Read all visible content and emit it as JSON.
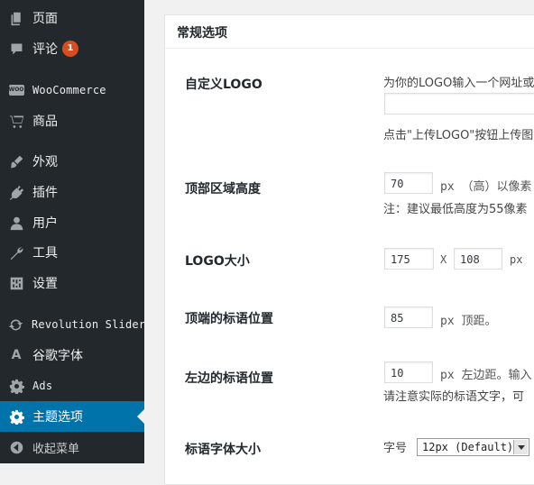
{
  "sidebar": {
    "items": [
      {
        "label": "页面",
        "icon": "pages-icon"
      },
      {
        "label": "评论",
        "icon": "comments-icon",
        "badge": "1"
      },
      {
        "label": "WooCommerce",
        "icon": "woocommerce-icon",
        "icon_text": "WOO"
      },
      {
        "label": "商品",
        "icon": "cart-icon"
      },
      {
        "label": "外观",
        "icon": "brush-icon"
      },
      {
        "label": "插件",
        "icon": "plugin-icon"
      },
      {
        "label": "用户",
        "icon": "user-icon"
      },
      {
        "label": "工具",
        "icon": "wrench-icon"
      },
      {
        "label": "设置",
        "icon": "settings-sliders-icon"
      },
      {
        "label": "Revolution Slider",
        "icon": "refresh-icon"
      },
      {
        "label": "谷歌字体",
        "icon": "font-icon",
        "icon_text": "A"
      },
      {
        "label": "Ads",
        "icon": "gear-icon"
      },
      {
        "label": "主题选项",
        "icon": "gear-icon",
        "active": true
      },
      {
        "label": "收起菜单",
        "icon": "collapse-icon"
      }
    ],
    "active_color": "#0073aa",
    "background": "#23282d",
    "badge_color": "#d54e21"
  },
  "panel": {
    "title": "常规选项",
    "logo": {
      "label": "自定义LOGO",
      "desc_top": "为你的LOGO输入一个网址或",
      "input_value": "",
      "desc_bottom": "点击\"上传LOGO\"按钮上传图"
    },
    "header_height": {
      "label": "顶部区域高度",
      "value": "70",
      "unit_text": "px （高）以像素",
      "note": "注：建议最低高度为55像素"
    },
    "logo_size": {
      "label": "LOGO大小",
      "width": "175",
      "sep": "X",
      "height": "108",
      "unit": "px"
    },
    "tagline_top": {
      "label": "顶端的标语位置",
      "value": "85",
      "unit_text": "px 顶距。"
    },
    "tagline_left": {
      "label": "左边的标语位置",
      "value": "10",
      "unit_text": "px 左边距。输入",
      "note": "请注意实际的标语文字，可"
    },
    "tagline_font": {
      "label": "标语字体大小",
      "prefix": "字号",
      "selected": "12px (Default)"
    }
  }
}
